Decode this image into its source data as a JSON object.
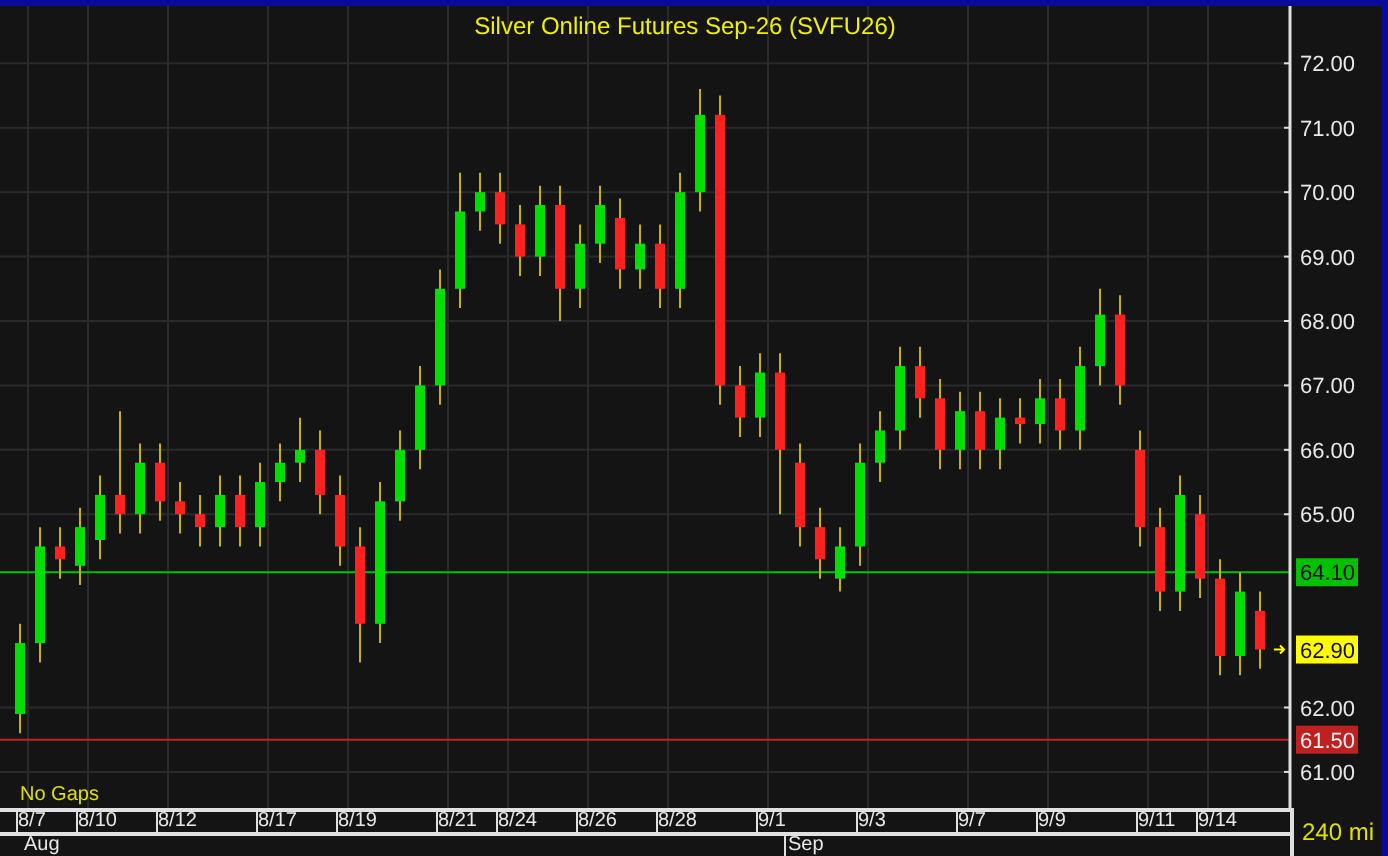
{
  "chart": {
    "chart_data": {
      "type": "candlestick",
      "title": "Silver Online Futures Sep-26 (SVFU26)",
      "categories": [
        null,
        "8/7",
        null,
        null,
        "8/10",
        null,
        null,
        null,
        "8/12",
        null,
        null,
        null,
        null,
        "8/17",
        null,
        null,
        null,
        "8/19",
        null,
        null,
        null,
        null,
        "8/21",
        null,
        null,
        "8/24",
        null,
        null,
        null,
        "8/26",
        null,
        null,
        null,
        "8/28",
        null,
        null,
        null,
        null,
        "9/1",
        null,
        null,
        null,
        null,
        "9/3",
        null,
        null,
        null,
        null,
        "9/7",
        null,
        null,
        null,
        "9/9",
        null,
        null,
        null,
        null,
        "9/11",
        null,
        null,
        "9/14",
        null,
        null
      ],
      "ohlc": [
        [
          61.9,
          63.3,
          61.6,
          63.0
        ],
        [
          63.0,
          64.8,
          62.7,
          64.5
        ],
        [
          64.5,
          64.8,
          64.0,
          64.3
        ],
        [
          64.2,
          65.1,
          63.9,
          64.8
        ],
        [
          64.6,
          65.6,
          64.3,
          65.3
        ],
        [
          65.3,
          66.6,
          64.7,
          65.0
        ],
        [
          65.0,
          66.1,
          64.7,
          65.8
        ],
        [
          65.8,
          66.1,
          64.9,
          65.2
        ],
        [
          65.2,
          65.5,
          64.7,
          65.0
        ],
        [
          65.0,
          65.3,
          64.5,
          64.8
        ],
        [
          64.8,
          65.6,
          64.5,
          65.3
        ],
        [
          65.3,
          65.6,
          64.5,
          64.8
        ],
        [
          64.8,
          65.8,
          64.5,
          65.5
        ],
        [
          65.5,
          66.1,
          65.2,
          65.8
        ],
        [
          65.8,
          66.5,
          65.5,
          66.0
        ],
        [
          66.0,
          66.3,
          65.0,
          65.3
        ],
        [
          65.3,
          65.6,
          64.2,
          64.5
        ],
        [
          64.5,
          64.8,
          62.7,
          63.3
        ],
        [
          63.3,
          65.5,
          63.0,
          65.2
        ],
        [
          65.2,
          66.3,
          64.9,
          66.0
        ],
        [
          66.0,
          67.3,
          65.7,
          67.0
        ],
        [
          67.0,
          68.8,
          66.7,
          68.5
        ],
        [
          68.5,
          70.3,
          68.2,
          69.7
        ],
        [
          69.7,
          70.3,
          69.4,
          70.0
        ],
        [
          70.0,
          70.3,
          69.2,
          69.5
        ],
        [
          69.5,
          69.8,
          68.7,
          69.0
        ],
        [
          69.0,
          70.1,
          68.7,
          69.8
        ],
        [
          69.8,
          70.1,
          68.0,
          68.5
        ],
        [
          68.5,
          69.5,
          68.2,
          69.2
        ],
        [
          69.2,
          70.1,
          68.9,
          69.8
        ],
        [
          69.6,
          69.9,
          68.5,
          68.8
        ],
        [
          68.8,
          69.5,
          68.5,
          69.2
        ],
        [
          69.2,
          69.5,
          68.2,
          68.5
        ],
        [
          68.5,
          70.3,
          68.2,
          70.0
        ],
        [
          70.0,
          71.6,
          69.7,
          71.2
        ],
        [
          71.2,
          71.5,
          66.7,
          67.0
        ],
        [
          67.0,
          67.3,
          66.2,
          66.5
        ],
        [
          66.5,
          67.5,
          66.2,
          67.2
        ],
        [
          67.2,
          67.5,
          65.0,
          66.0
        ],
        [
          65.8,
          66.1,
          64.5,
          64.8
        ],
        [
          64.8,
          65.1,
          64.0,
          64.3
        ],
        [
          64.0,
          64.8,
          63.8,
          64.5
        ],
        [
          64.5,
          66.1,
          64.2,
          65.8
        ],
        [
          65.8,
          66.6,
          65.5,
          66.3
        ],
        [
          66.3,
          67.6,
          66.0,
          67.3
        ],
        [
          67.3,
          67.6,
          66.5,
          66.8
        ],
        [
          66.8,
          67.1,
          65.7,
          66.0
        ],
        [
          66.0,
          66.9,
          65.7,
          66.6
        ],
        [
          66.6,
          66.9,
          65.7,
          66.0
        ],
        [
          66.0,
          66.8,
          65.7,
          66.5
        ],
        [
          66.5,
          66.8,
          66.1,
          66.4
        ],
        [
          66.4,
          67.1,
          66.1,
          66.8
        ],
        [
          66.8,
          67.1,
          66.0,
          66.3
        ],
        [
          66.3,
          67.6,
          66.0,
          67.3
        ],
        [
          67.3,
          68.5,
          67.0,
          68.1
        ],
        [
          68.1,
          68.4,
          66.7,
          67.0
        ],
        [
          66.0,
          66.3,
          64.5,
          64.8
        ],
        [
          64.8,
          65.1,
          63.5,
          63.8
        ],
        [
          63.8,
          65.6,
          63.5,
          65.3
        ],
        [
          65.0,
          65.3,
          63.7,
          64.0
        ],
        [
          64.0,
          64.3,
          62.5,
          62.8
        ],
        [
          62.8,
          64.1,
          62.5,
          63.8
        ],
        [
          63.5,
          63.8,
          62.6,
          62.9
        ]
      ],
      "ylim": [
        60.44,
        72.89
      ],
      "grid": true,
      "yticks": [
        {
          "value": 72,
          "label": "72.00"
        },
        {
          "value": 71,
          "label": "71.00"
        },
        {
          "value": 70,
          "label": "70.00"
        },
        {
          "value": 69,
          "label": "69.00"
        },
        {
          "value": 68,
          "label": "68.00"
        },
        {
          "value": 67,
          "label": "67.00"
        },
        {
          "value": 66,
          "label": "66.00"
        },
        {
          "value": 65,
          "label": "65.00"
        },
        {
          "value": 62,
          "label": "62.00"
        },
        {
          "value": 61,
          "label": "61.00"
        }
      ],
      "ref_lines": [
        {
          "axis": "y",
          "value": 64.1,
          "label": "64.10",
          "color": "#00c000"
        },
        {
          "axis": "y",
          "value": 61.5,
          "label": "61.50",
          "color": "#c02020"
        }
      ]
    },
    "last_price": {
      "label": "62.90"
    },
    "note": "No Gaps",
    "month_labels": [
      "Aug",
      "Sep"
    ],
    "interval": "240 mi"
  }
}
